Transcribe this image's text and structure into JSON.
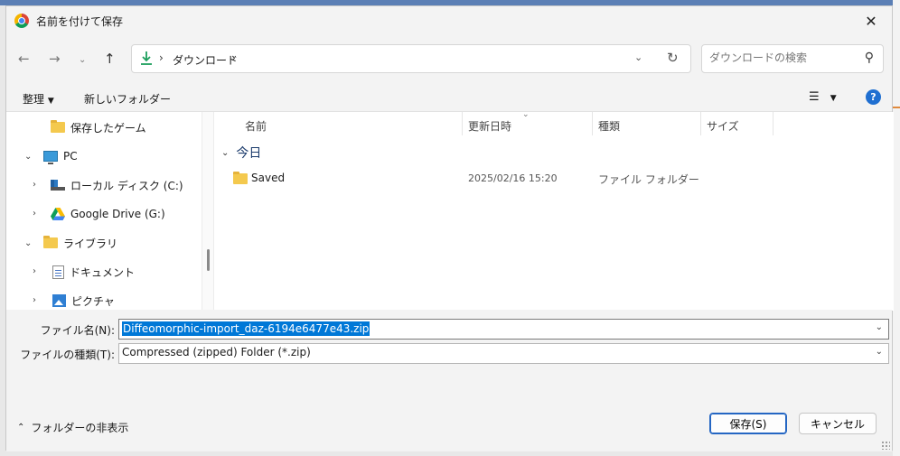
{
  "window": {
    "title": "名前を付けて保存"
  },
  "address": {
    "location": "ダウンロード"
  },
  "search": {
    "placeholder": "ダウンロードの検索"
  },
  "toolbar": {
    "organize": "整理",
    "new_folder": "新しいフォルダー"
  },
  "nav_tree": [
    {
      "label": "保存したゲーム",
      "icon": "folder-icon"
    },
    {
      "label": "PC",
      "icon": "pc-icon"
    },
    {
      "label": "ローカル ディスク (C:)",
      "icon": "disk-icon"
    },
    {
      "label": "Google Drive (G:)",
      "icon": "google-drive-icon"
    },
    {
      "label": "ライブラリ",
      "icon": "folder-icon"
    },
    {
      "label": "ドキュメント",
      "icon": "document-icon"
    },
    {
      "label": "ピクチャ",
      "icon": "pictures-icon"
    }
  ],
  "columns": {
    "name": "名前",
    "modified": "更新日時",
    "type": "種類",
    "size": "サイズ"
  },
  "group_label": "今日",
  "files": [
    {
      "name": "Saved",
      "modified": "2025/02/16 15:20",
      "type": "ファイル フォルダー",
      "size": ""
    }
  ],
  "filename": {
    "label": "ファイル名(N):",
    "value": "Diffeomorphic-import_daz-6194e6477e43.zip"
  },
  "filetype": {
    "label": "ファイルの種類(T):",
    "value": "Compressed (zipped) Folder (*.zip)"
  },
  "footer": {
    "hide_folders": "フォルダーの非表示",
    "save": "保存(S)",
    "cancel": "キャンセル"
  },
  "colors": {
    "accent": "#0078d7",
    "folder": "#f4c94e",
    "help": "#1f6fd1"
  }
}
